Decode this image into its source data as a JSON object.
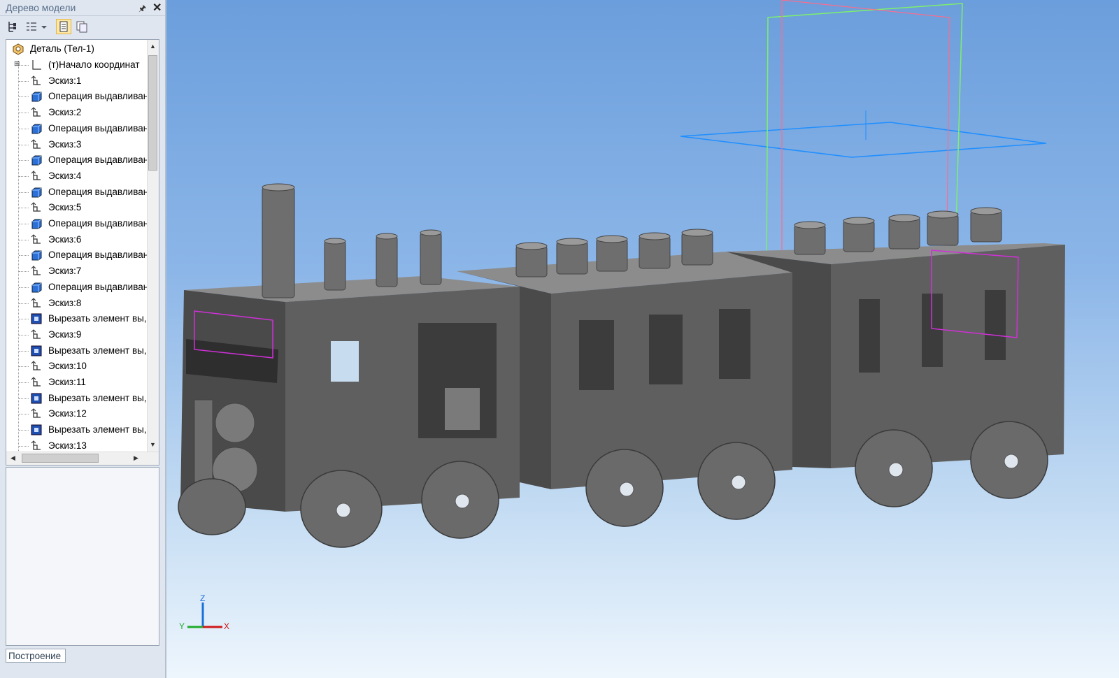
{
  "panel": {
    "title": "Дерево модели",
    "pin_glyph": "🖈",
    "close_glyph": "✕",
    "toolbar": [
      {
        "icon": "tree-structure-icon"
      },
      {
        "icon": "tree-list-icon"
      },
      {
        "icon": "dropdown-arrow-icon"
      },
      {
        "icon": "panel-view-icon",
        "active": true
      },
      {
        "icon": "panel-split-icon"
      }
    ],
    "bottom_tab": "Построение"
  },
  "tree": {
    "root": "Деталь (Тел-1)",
    "items": [
      {
        "label": "(т)Начало координат",
        "icon": "origin-icon"
      },
      {
        "label": "Эскиз:1",
        "icon": "sketch-icon"
      },
      {
        "label": "Операция выдавливан",
        "icon": "extrude-icon"
      },
      {
        "label": "Эскиз:2",
        "icon": "sketch-icon"
      },
      {
        "label": "Операция выдавливан",
        "icon": "extrude-icon"
      },
      {
        "label": "Эскиз:3",
        "icon": "sketch-icon"
      },
      {
        "label": "Операция выдавливан",
        "icon": "extrude-icon"
      },
      {
        "label": "Эскиз:4",
        "icon": "sketch-icon"
      },
      {
        "label": "Операция выдавливан",
        "icon": "extrude-icon"
      },
      {
        "label": "Эскиз:5",
        "icon": "sketch-icon"
      },
      {
        "label": "Операция выдавливан",
        "icon": "extrude-icon"
      },
      {
        "label": "Эскиз:6",
        "icon": "sketch-icon"
      },
      {
        "label": "Операция выдавливан",
        "icon": "extrude-icon"
      },
      {
        "label": "Эскиз:7",
        "icon": "sketch-icon"
      },
      {
        "label": "Операция выдавливан",
        "icon": "extrude-icon"
      },
      {
        "label": "Эскиз:8",
        "icon": "sketch-icon"
      },
      {
        "label": "Вырезать элемент вы,",
        "icon": "cut-icon"
      },
      {
        "label": "Эскиз:9",
        "icon": "sketch-icon"
      },
      {
        "label": "Вырезать элемент вы,",
        "icon": "cut-icon"
      },
      {
        "label": "Эскиз:10",
        "icon": "sketch-icon"
      },
      {
        "label": "Эскиз:11",
        "icon": "sketch-icon"
      },
      {
        "label": "Вырезать элемент вы,",
        "icon": "cut-icon"
      },
      {
        "label": "Эскиз:12",
        "icon": "sketch-icon"
      },
      {
        "label": "Вырезать элемент вы,",
        "icon": "cut-icon"
      },
      {
        "label": "Эскиз:13",
        "icon": "sketch-icon"
      }
    ]
  },
  "axes": {
    "z": "Z",
    "y": "Y",
    "x": "X"
  },
  "colors": {
    "body": "#5f5f5f",
    "body_top": "#8c8c8c",
    "body_dark": "#4a4a4a",
    "plane_blue": "#1f8fff",
    "plane_green": "#7df06a",
    "plane_pink": "#ff6b8a",
    "sketch_magenta": "#d030d8"
  }
}
